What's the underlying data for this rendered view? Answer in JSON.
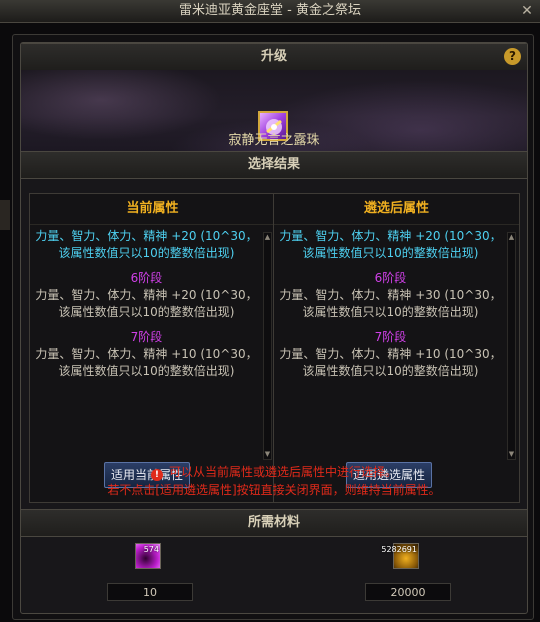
{
  "window": {
    "title": "雷米迪亚黄金座堂 - 黄金之祭坛"
  },
  "upgrade": {
    "header": "升级",
    "help_icon": "question-icon",
    "item_name": "寂静无言之露珠"
  },
  "results": {
    "header": "选择结果",
    "current": {
      "title": "当前属性",
      "para1": "力量、智力、体力、精神 +20 (10^30，该属性数值只以10的整数倍出现)",
      "stage6": "6阶段",
      "para2": "力量、智力、体力、精神 +20 (10^30，该属性数值只以10的整数倍出现)",
      "stage7": "7阶段",
      "para3": "力量、智力、体力、精神 +10 (10^30，该属性数值只以10的整数倍出现)",
      "button": "适用当前属性"
    },
    "selected": {
      "title": "遴选后属性",
      "para1": "力量、智力、体力、精神 +20 (10^30，该属性数值只以10的整数倍出现)",
      "stage6": "6阶段",
      "para2": "力量、智力、体力、精神 +30 (10^30，该属性数值只以10的整数倍出现)",
      "stage7": "7阶段",
      "para3": "力量、智力、体力、精神 +10 (10^30，该属性数值只以10的整数倍出现)",
      "button": "适用遴选属性"
    },
    "warning1": "可以从当前属性或遴选后属性中进行选择。",
    "warning2": "若不点击[适用遴选属性]按钮直接关闭界面，则维持当前属性。"
  },
  "materials": {
    "header": "所需材料",
    "items": [
      {
        "stock": "574",
        "required": "10"
      },
      {
        "stock": "5282691",
        "required": "20000"
      }
    ]
  },
  "colors": {
    "accent": "#f0b020",
    "cyan": "#4ed0f0",
    "stage": "#d040e8",
    "warning": "#e02a1a"
  }
}
